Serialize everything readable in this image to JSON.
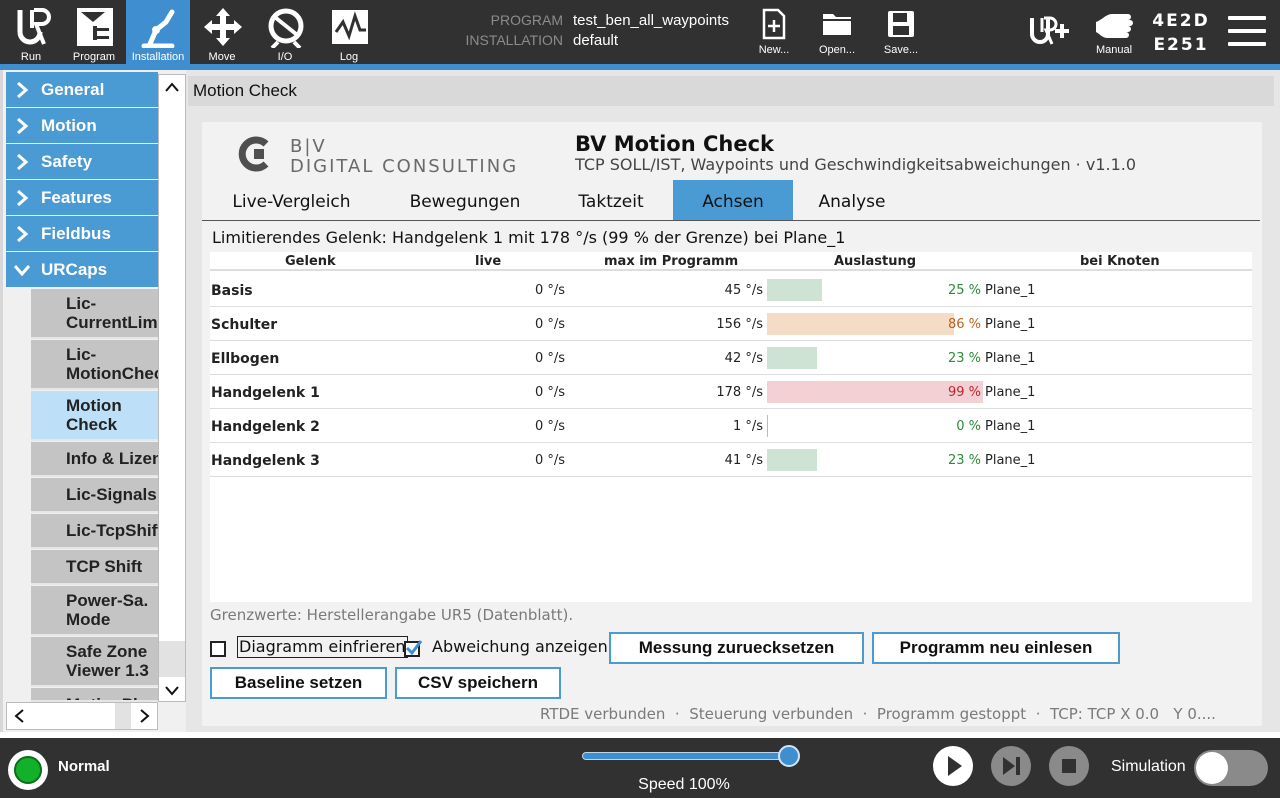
{
  "topbar": {
    "nav": [
      {
        "label": "Run",
        "icon": "ur-logo-icon"
      },
      {
        "label": "Program",
        "icon": "program-icon"
      },
      {
        "label": "Installation",
        "icon": "installation-icon",
        "active": true
      },
      {
        "label": "Move",
        "icon": "move-arrows-icon"
      },
      {
        "label": "I/O",
        "icon": "io-icon"
      },
      {
        "label": "Log",
        "icon": "log-icon"
      }
    ],
    "program_key": "PROGRAM",
    "program_value": "test_ben_all_waypoints",
    "installation_key": "INSTALLATION",
    "installation_value": "default",
    "file": [
      {
        "label": "New...",
        "icon": "new-file-icon"
      },
      {
        "label": "Open...",
        "icon": "open-folder-icon"
      },
      {
        "label": "Save...",
        "icon": "save-icon"
      }
    ],
    "mode_label": "Manual",
    "robot_id_line1": "4E2D",
    "robot_id_line2": "E251"
  },
  "sidebar": {
    "groups": [
      "General",
      "Motion",
      "Safety",
      "Features",
      "Fieldbus",
      "URCaps"
    ],
    "urcaps_items": [
      "Lic-\nCurrentLimit",
      "Lic-\nMotionCheck",
      "Motion\nCheck",
      "Info & Lizenz",
      "Lic-Signals",
      "Lic-TcpShift",
      "TCP Shift",
      "Power-Sa.\nMode",
      "Safe Zone\nViewer 1.3",
      "MotionPlu"
    ],
    "selected_index": 2
  },
  "main": {
    "header": "Motion Check",
    "brand_line1": "B|V",
    "brand_line2": "DIGITAL CONSULTING",
    "title": "BV Motion Check",
    "subtitle": "TCP SOLL/IST, Waypoints und Geschwindigkeitsabweichungen · v1.1.0",
    "tabs": [
      "Live-Vergleich",
      "Bewegungen",
      "Taktzeit",
      "Achsen",
      "Analyse"
    ],
    "active_tab": "Achsen",
    "limit_text": "Limitierendes Gelenk: Handgelenk 1 mit 178 °/s (99 % der Grenze) bei Plane_1",
    "table": {
      "headers": [
        "Gelenk",
        "live",
        "max im Programm",
        "Auslastung",
        "bei Knoten"
      ],
      "rows": [
        {
          "joint": "Basis",
          "live": "0 °/s",
          "max": "45 °/s",
          "load": 25,
          "load_text": "25 %",
          "node": "Plane_1",
          "level": "ok"
        },
        {
          "joint": "Schulter",
          "live": "0 °/s",
          "max": "156 °/s",
          "load": 86,
          "load_text": "86 %",
          "node": "Plane_1",
          "level": "warn"
        },
        {
          "joint": "Ellbogen",
          "live": "0 °/s",
          "max": "42 °/s",
          "load": 23,
          "load_text": "23 %",
          "node": "Plane_1",
          "level": "ok"
        },
        {
          "joint": "Handgelenk 1",
          "live": "0 °/s",
          "max": "178 °/s",
          "load": 99,
          "load_text": "99 %",
          "node": "Plane_1",
          "level": "crit"
        },
        {
          "joint": "Handgelenk 2",
          "live": "0 °/s",
          "max": "1 °/s",
          "load": 0,
          "load_text": "0 %",
          "node": "Plane_1",
          "level": "ok"
        },
        {
          "joint": "Handgelenk 3",
          "live": "0 °/s",
          "max": "41 °/s",
          "load": 23,
          "load_text": "23 %",
          "node": "Plane_1",
          "level": "ok"
        }
      ]
    },
    "grenzwerte": "Grenzwerte: Herstellerangabe UR5 (Datenblatt).",
    "freeze_label": "Diagramm einfrieren",
    "freeze_checked": false,
    "deviation_label": "Abweichung anzeigen",
    "deviation_checked": true,
    "btn_reset": "Messung zuruecksetzen",
    "btn_reload": "Programm neu einlesen",
    "btn_baseline": "Baseline setzen",
    "btn_csv": "CSV speichern",
    "status_line": "RTDE verbunden  ·  Steuerung verbunden  ·  Programm gestoppt  ·  TCP: TCP X 0.0   Y 0...."
  },
  "colors": {
    "ok_text": "#2e8b3a",
    "ok_bar": "#cfe3d5",
    "warn_text": "#c0621a",
    "warn_bar": "#f5dcc6",
    "crit_text": "#c0242c",
    "crit_bar": "#f2d0d3",
    "accent": "#4a9ad4"
  },
  "bottombar": {
    "status": "Normal",
    "speed_label": "Speed 100%",
    "speed_value": 100,
    "simulation_label": "Simulation",
    "simulation_on": false
  }
}
